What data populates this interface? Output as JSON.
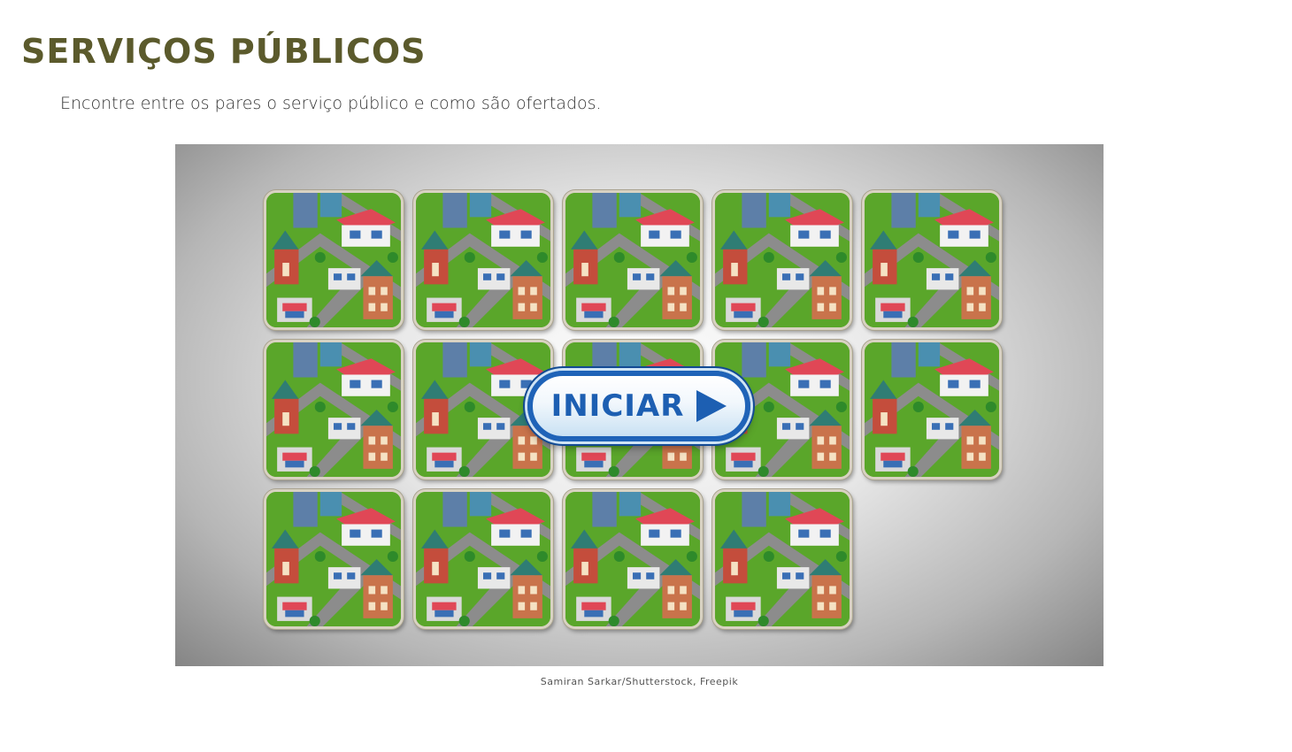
{
  "header": {
    "title": "SERVIÇOS PÚBLICOS",
    "instruction": "Encontre entre os pares o serviço público e como são ofertados."
  },
  "game": {
    "card_rows": [
      5,
      5,
      4
    ],
    "card_back_icon": "isometric-city-illustration",
    "start_button": {
      "label": "INICIAR",
      "icon": "play-icon"
    }
  },
  "credit": "Samiran Sarkar/Shutterstock, Freepik",
  "colors": {
    "title": "#5b5a2c",
    "button_blue": "#1d5fb2",
    "card_grass": "#5aa62a",
    "card_road": "#8c8c8c"
  }
}
